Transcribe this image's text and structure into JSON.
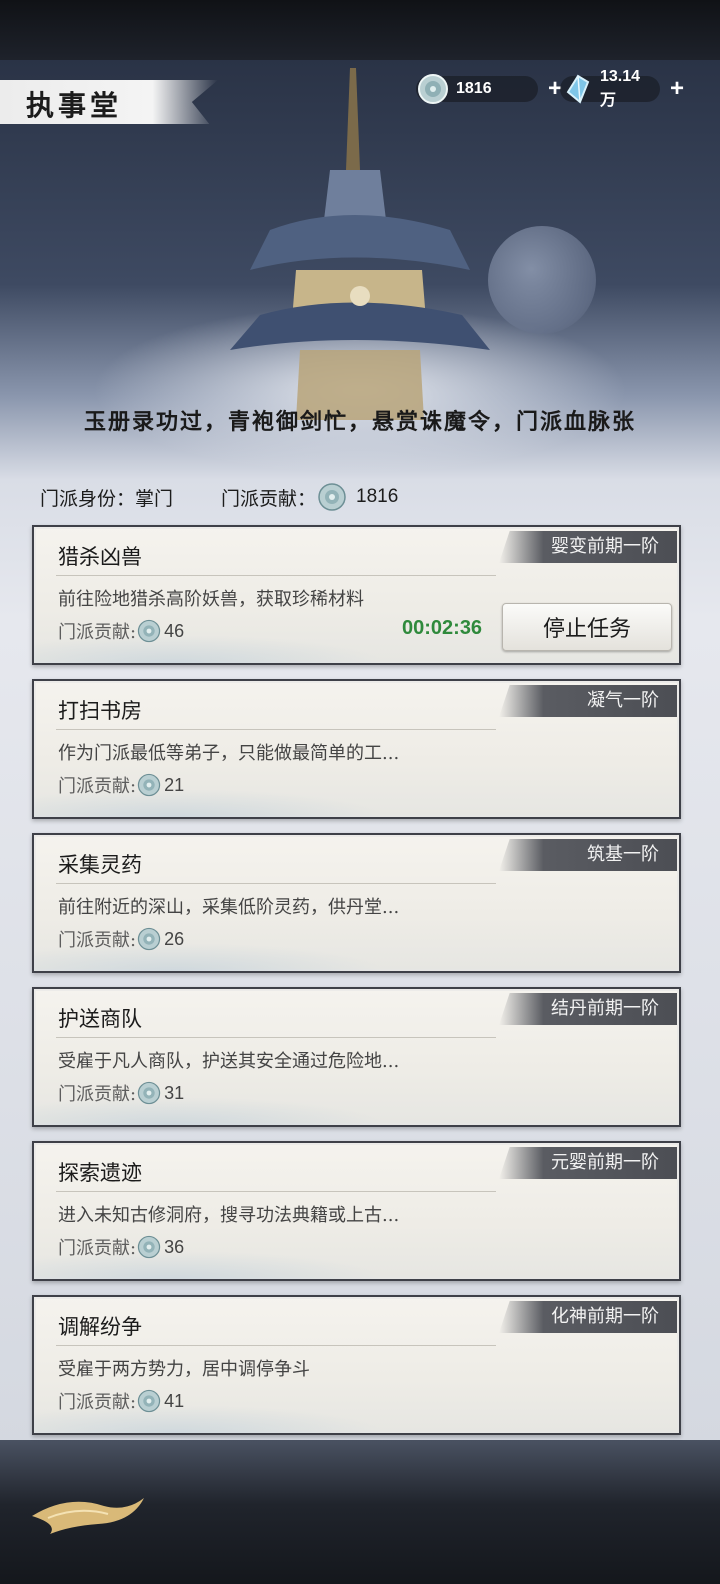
{
  "header": {
    "title": "执事堂",
    "resources": [
      {
        "icon": "jade-coin-icon",
        "value": "1816",
        "plus": "+"
      },
      {
        "icon": "spirit-crystal-icon",
        "value": "13.14万",
        "plus": "+"
      }
    ]
  },
  "slogan": "玉册录功过，青袍御剑忙，悬赏诛魔令，门派血脉张",
  "identity": {
    "role_label": "门派身份：",
    "role_value": "掌门",
    "contribution_label": "门派贡献：",
    "contribution_value": "1816"
  },
  "tasks": [
    {
      "name": "猎杀凶兽",
      "tag": "婴变前期一阶",
      "desc": "前往险地猎杀高阶妖兽，获取珍稀材料",
      "contrib_label": "门派贡献:",
      "contrib": "46",
      "timer": "00:02:36",
      "button": "停止任务"
    },
    {
      "name": "打扫书房",
      "tag": "凝气一阶",
      "desc": "作为门派最低等弟子，只能做最简单的工...",
      "contrib_label": "门派贡献:",
      "contrib": "21"
    },
    {
      "name": "采集灵药",
      "tag": "筑基一阶",
      "desc": "前往附近的深山，采集低阶灵药，供丹堂...",
      "contrib_label": "门派贡献:",
      "contrib": "26"
    },
    {
      "name": "护送商队",
      "tag": "结丹前期一阶",
      "desc": "受雇于凡人商队，护送其安全通过危险地...",
      "contrib_label": "门派贡献:",
      "contrib": "31"
    },
    {
      "name": "探索遗迹",
      "tag": "元婴前期一阶",
      "desc": "进入未知古修洞府，搜寻功法典籍或上古...",
      "contrib_label": "门派贡献:",
      "contrib": "36"
    },
    {
      "name": "调解纷争",
      "tag": "化神前期一阶",
      "desc": "受雇于两方势力，居中调停争斗",
      "contrib_label": "门派贡献:",
      "contrib": "41"
    }
  ],
  "colors": {
    "timer": "#2f8a3c",
    "tag_bg": "#4c4e54"
  }
}
